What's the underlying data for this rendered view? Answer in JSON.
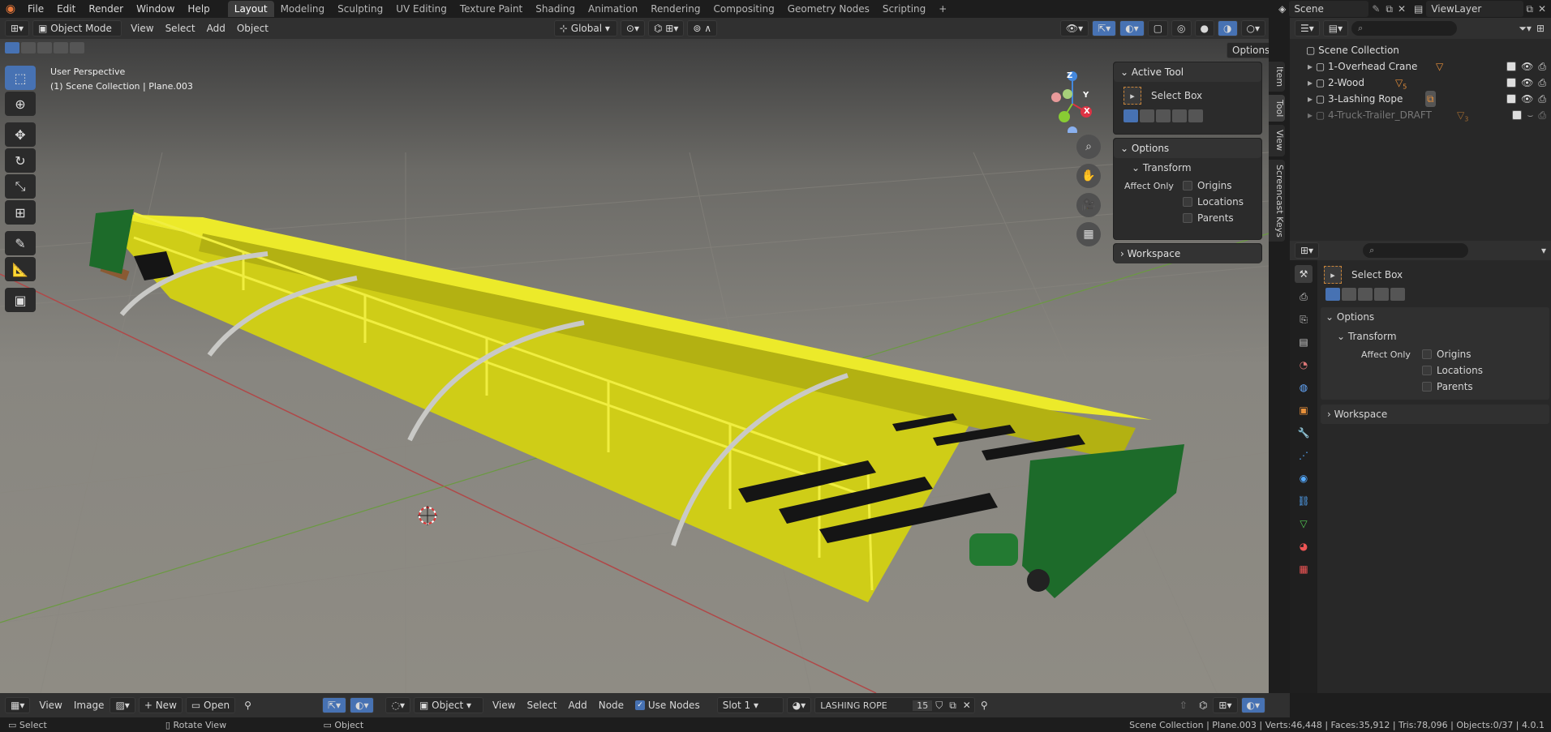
{
  "app": {
    "logo": "blender-logo"
  },
  "menu": [
    "File",
    "Edit",
    "Render",
    "Window",
    "Help"
  ],
  "workspaces": [
    "Layout",
    "Modeling",
    "Sculpting",
    "UV Editing",
    "Texture Paint",
    "Shading",
    "Animation",
    "Rendering",
    "Compositing",
    "Geometry Nodes",
    "Scripting"
  ],
  "active_workspace": "Layout",
  "scene": {
    "label": "Scene",
    "view_layer": "ViewLayer"
  },
  "viewport_header": {
    "mode": "Object Mode",
    "menus": [
      "View",
      "Select",
      "Add",
      "Object"
    ],
    "orientation": "Global",
    "options": "Options"
  },
  "viewport": {
    "perspective": "User Perspective",
    "collection_info": "(1) Scene Collection | Plane.003",
    "gizmo": {
      "x": "X",
      "y": "Y",
      "z": "Z"
    }
  },
  "n_panel": {
    "tabs": [
      "Item",
      "Tool",
      "View",
      "Screencast Keys"
    ],
    "active_tool_title": "Active Tool",
    "tool_name": "Select Box",
    "options_title": "Options",
    "transform_title": "Transform",
    "affect_only": "Affect Only",
    "checks": [
      "Origins",
      "Locations",
      "Parents"
    ],
    "workspace_title": "Workspace"
  },
  "outliner": {
    "root": "Scene Collection",
    "items": [
      {
        "name": "1-Overhead Crane",
        "badge": ""
      },
      {
        "name": "2-Wood",
        "badge": "5"
      },
      {
        "name": "3-Lashing Rope",
        "badge": ""
      },
      {
        "name": "4-Truck-Trailer_DRAFT",
        "badge": "3"
      }
    ]
  },
  "properties": {
    "tool_name": "Select Box",
    "options_title": "Options",
    "transform_title": "Transform",
    "affect_only": "Affect Only",
    "checks": [
      "Origins",
      "Locations",
      "Parents"
    ],
    "workspace_title": "Workspace"
  },
  "node_header": {
    "view": "View",
    "image": "Image",
    "new": "New",
    "open": "Open",
    "object": "Object",
    "menus": [
      "View",
      "Select",
      "Add",
      "Node"
    ],
    "use_nodes": "Use Nodes",
    "slot": "Slot 1",
    "material": "LASHING ROPE",
    "users": "15"
  },
  "status": {
    "select": "Select",
    "rotate": "Rotate View",
    "object": "Object",
    "stats": "Scene Collection | Plane.003 | Verts:46,448 | Faces:35,912 | Tris:78,096 | Objects:0/37 | 4.0.1"
  },
  "colors": {
    "accent": "#4772b3",
    "crane": "#e8e61a",
    "green": "#1d6b2a",
    "wood": "#8a5a33"
  }
}
